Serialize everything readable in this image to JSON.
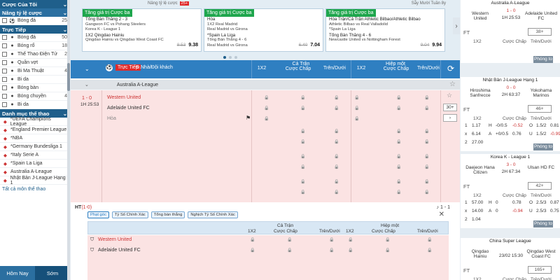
{
  "left": {
    "my_bets_title": "Cược Của Tôi",
    "odds_title": "Nâng tỷ lệ cược",
    "odds_items": [
      {
        "label": "Bóng đá",
        "count": "25"
      }
    ],
    "live_title": "Trực Tiếp",
    "live_items": [
      {
        "label": "Bóng đá",
        "count": "50",
        "icon": "soccer-ball-icon"
      },
      {
        "label": "Bóng rổ",
        "count": "18",
        "icon": "basketball-icon"
      },
      {
        "label": "Thể Thao Điện Tử",
        "count": "2",
        "icon": "esports-icon"
      },
      {
        "label": "Quần vợt",
        "count": "",
        "icon": "tennis-icon"
      },
      {
        "label": "Bi Ma Thuật",
        "count": "4",
        "icon": "magic-ball-icon"
      },
      {
        "label": "Bi da",
        "count": "",
        "icon": "billiards-icon"
      },
      {
        "label": "Bóng bàn",
        "count": "",
        "icon": "table-tennis-icon"
      },
      {
        "label": "Bóng chuyền",
        "count": "4",
        "icon": "volleyball-icon"
      },
      {
        "label": "Bi da",
        "count": "",
        "icon": "billiards-icon"
      }
    ],
    "category_title": "Danh mục thể thao",
    "leagues": [
      "*UEFA Champions League",
      "*England Premier League",
      "*NBA",
      "*Germany Bundesliga 1",
      "*Italy Serie A",
      "*Spain La Liga",
      "Australia A-League",
      "Nhật Bản J-League Hạng 1"
    ],
    "more_link": "Tất cả môn thể thao",
    "tabs": [
      "Hôm Nay",
      "Sớm"
    ]
  },
  "main": {
    "topstrip": {
      "text": "Nâng tỷ lệ cược",
      "badge": "25+",
      "right": "Sẵy Mười Tuần 8y"
    },
    "cards": [
      {
        "title": "Tăng giá trị Cược ba",
        "lines": [
          "Tổng Bàn Thắng 2 - 3",
          "Gangwon FC vs Pohang Steelers",
          "Korea K - League 1",
          "1X2 Qingdao Hainiu",
          "Qingdao Hainiu vs Qingdao West Coast FC"
        ],
        "old": "8.53",
        "new": "9.38"
      },
      {
        "title": "Tăng giá trị Cược ba",
        "lines": [
          "Hòa",
          "1X2 Real Madrid",
          "Real Madrid vs Girona",
          "*Spain La Liga",
          "Tổng Bàn Thắng 4 - 6",
          "Real Madrid vs Girona"
        ],
        "old": "6.40",
        "new": "7.04"
      },
      {
        "title": "Tăng giá trị Cược ba",
        "lines": [
          "Hòa Trận/Cả Trận Athletic Bilbao/Athletic Bilbao",
          "Athletic Bilbao vs Real Valladolid",
          "*Spain La Liga",
          "Tổng Bàn Thắng 4 - 6",
          "Newcastle United vs Nottingham Forest"
        ],
        "old": "9.04",
        "new": "9.94"
      }
    ],
    "header": {
      "live": "Trực Tiếp",
      "label": "Đ.Nhà/Đội khách",
      "full": "Cả Trận",
      "half": "Hiệp một",
      "c1": "1X2",
      "c2": "Cược Chấp",
      "c3": "Trên/Dưới",
      "c4": "1X2",
      "c5": "Cược Chấp",
      "c6": "Trên/Dưới"
    },
    "league": "Australia A-League",
    "match": {
      "score": "1 - 0",
      "time": "1H 25:53",
      "home": "Western United",
      "away": "Adelaide United FC",
      "draw": "Hòa",
      "more": "30+"
    },
    "ht": {
      "label": "HT",
      "score": "(1-0)",
      "result": "1 - 1"
    },
    "chips": [
      "Phạt góc",
      "Tỷ Số Chính Xác",
      "Tổng bàn thắng",
      "Nghịch Tỷ Số Chính Xác"
    ],
    "sub": {
      "full": "Cả Trận",
      "half": "Hiệp một",
      "c1": "1X2",
      "c2": "Cược Chấp",
      "c3": "Trên/Dưới",
      "c4": "1X2",
      "c5": "Cược Chấp",
      "c6": "Trên/Dưới",
      "home": "Western United",
      "away": "Adelaide United FC"
    }
  },
  "right": {
    "cards": [
      {
        "league": "Australia A-League",
        "home": "Western United",
        "away": "Adelaide United FC",
        "time": "1H 25:53",
        "score": "1 - 0",
        "ft": "FT",
        "more": "38+",
        "rows": []
      },
      {
        "league": "Nhật Bản J-League Hạng 1",
        "home": "Hiroshima Sanfrecce",
        "away": "Yokohama Marinos",
        "time": "2H 63:37",
        "score": "0 - 0",
        "ft": "FT",
        "more": "46+",
        "rows": [
          [
            "1",
            "1.17",
            "H",
            "-0/0.5",
            "-0.52",
            "O",
            "1.5/2",
            "0.81"
          ],
          [
            "x",
            "6.14",
            "A",
            "+0/0.5",
            "0.76",
            "U",
            "1.5/2",
            "-0.99"
          ],
          [
            "2",
            "27.00",
            "",
            "",
            "",
            "",
            "",
            ""
          ]
        ]
      },
      {
        "league": "Korea K - League 1",
        "home": "Daejeon Hana Citizen",
        "away": "Ulsan HD FC",
        "time": "2H 67:34",
        "score": "3 - 0",
        "ft": "FT",
        "more": "42+",
        "rows": [
          [
            "1",
            "57.00",
            "H",
            "0",
            "0.78",
            "O",
            "2.5/3",
            "0.87"
          ],
          [
            "x",
            "14.00",
            "A",
            "0",
            "-0.94",
            "U",
            "2.5/3",
            "0.75"
          ],
          [
            "2",
            "1.04",
            "",
            "",
            "",
            "",
            "",
            ""
          ]
        ]
      },
      {
        "league": "China Super League",
        "home": "Qingdao Hainiu",
        "away": "Qingdao West Coast FC",
        "time": "23/02 15:30",
        "score": "",
        "ft": "FT",
        "more": "165+",
        "rows": []
      }
    ],
    "grid_hdr": [
      "1X2",
      "Cược Chấp",
      "Trên/Dưới"
    ],
    "zoom": "Phóng to"
  }
}
